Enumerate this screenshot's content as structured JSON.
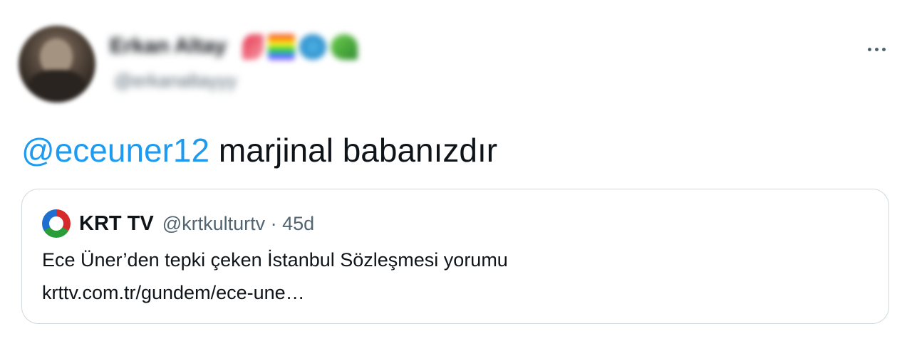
{
  "author": {
    "display_name": "Erkan Altay",
    "handle": "@erkanaltayyy"
  },
  "tweet": {
    "mention": "@eceuner12",
    "text": " marjinal babanızdır"
  },
  "quoted": {
    "name": "KRT TV",
    "meta": "@krtkulturtv · 45d",
    "text": "Ece Üner’den tepki çeken İstanbul Sözleşmesi yorumu",
    "link": "krttv.com.tr/gundem/ece-une…"
  },
  "icons": {
    "more": "more-horizontal-icon",
    "logo": "krt-logo-icon"
  },
  "colors": {
    "mention": "#1d9bf0",
    "secondary": "#536471",
    "border": "#cfd9de"
  }
}
